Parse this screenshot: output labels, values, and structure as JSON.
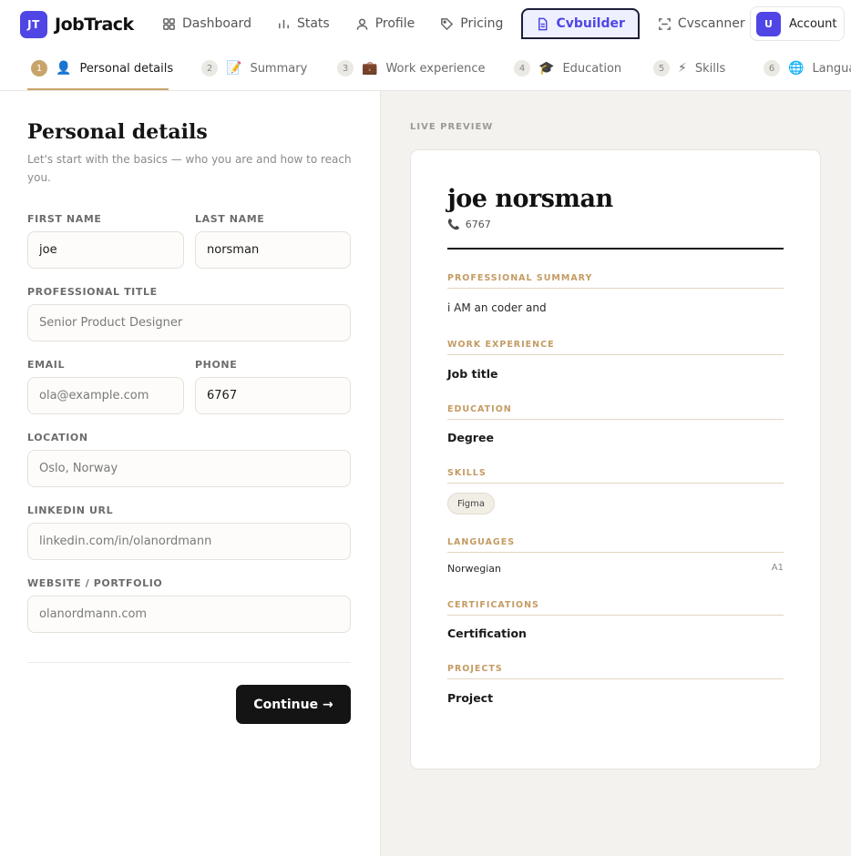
{
  "brand": {
    "logo_text": "JT",
    "name": "JobTrack",
    "color": "#4f46e5"
  },
  "nav": {
    "items": [
      {
        "label": "Dashboard",
        "icon": "grid-icon"
      },
      {
        "label": "Stats",
        "icon": "bar-chart-icon"
      },
      {
        "label": "Profile",
        "icon": "user-icon"
      },
      {
        "label": "Pricing",
        "icon": "tag-icon"
      },
      {
        "label": "Cvbuilder",
        "icon": "document-icon",
        "active": true
      },
      {
        "label": "Cvscanner",
        "icon": "scan-icon"
      }
    ],
    "account": {
      "avatar": "U",
      "label": "Account"
    }
  },
  "steps": [
    {
      "num": "1",
      "icon": "person-icon",
      "label": "Personal details",
      "active": true
    },
    {
      "num": "2",
      "icon": "memo-icon",
      "label": "Summary"
    },
    {
      "num": "3",
      "icon": "briefcase-icon",
      "label": "Work experience"
    },
    {
      "num": "4",
      "icon": "graduation-cap-icon",
      "label": "Education"
    },
    {
      "num": "5",
      "icon": "lightning-icon",
      "label": "Skills"
    },
    {
      "num": "6",
      "icon": "globe-icon",
      "label": "Langua"
    }
  ],
  "form": {
    "title": "Personal details",
    "subtitle": "Let's start with the basics — who you are and how to reach you.",
    "first_name": {
      "label": "FIRST NAME",
      "value": "joe"
    },
    "last_name": {
      "label": "LAST NAME",
      "value": "norsman"
    },
    "title_field": {
      "label": "PROFESSIONAL TITLE",
      "placeholder": "Senior Product Designer"
    },
    "email": {
      "label": "EMAIL",
      "placeholder": "ola@example.com"
    },
    "phone": {
      "label": "PHONE",
      "value": "6767"
    },
    "location": {
      "label": "LOCATION",
      "placeholder": "Oslo, Norway"
    },
    "linkedin": {
      "label": "LINKEDIN URL",
      "placeholder": "linkedin.com/in/olanordmann"
    },
    "website": {
      "label": "WEBSITE / PORTFOLIO",
      "placeholder": "olanordmann.com"
    },
    "continue_label": "Continue →"
  },
  "preview": {
    "label": "LIVE PREVIEW",
    "name": "joe norsman",
    "phone": "6767",
    "summary_title": "PROFESSIONAL SUMMARY",
    "summary_text": "i AM an coder and",
    "work_title": "WORK EXPERIENCE",
    "work_item": "Job title",
    "education_title": "EDUCATION",
    "education_item": "Degree",
    "skills_title": "SKILLS",
    "skill_chip": "Figma",
    "languages_title": "LANGUAGES",
    "language_name": "Norwegian",
    "language_level": "A1",
    "certifications_title": "CERTIFICATIONS",
    "certification_item": "Certification",
    "projects_title": "PROJECTS",
    "project_item": "Project"
  },
  "colors": {
    "accent": "#c8a46a",
    "brand": "#4f46e5",
    "dark_button": "#141414"
  }
}
